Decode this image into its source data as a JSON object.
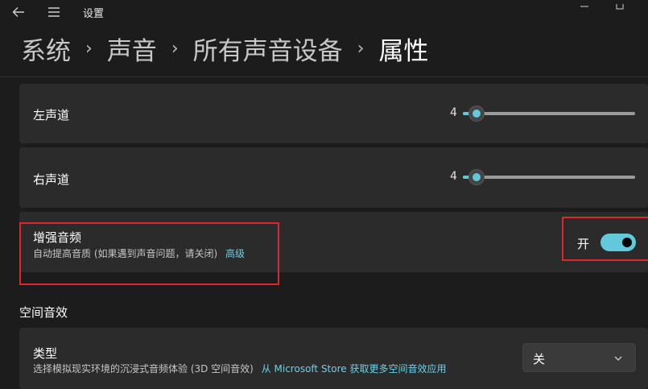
{
  "titlebar": {
    "back_icon": "back-arrow-icon",
    "menu_icon": "hamburger-menu-icon",
    "title": "设置",
    "minimize_icon": "minimize-icon",
    "maximize_icon": "maximize-icon"
  },
  "breadcrumb": {
    "items": [
      "系统",
      "声音",
      "所有声音设备",
      "属性"
    ],
    "separator": "›"
  },
  "left_channel": {
    "label": "左声道",
    "value": "4",
    "level_percent": 4
  },
  "right_channel": {
    "label": "右声道",
    "value": "4",
    "level_percent": 4
  },
  "enhance_audio": {
    "label": "增强音频",
    "description": "自动提高音质 (如果遇到声音问题，请关闭)",
    "link": "高级",
    "toggle_state": "开",
    "toggle_on": true
  },
  "spatial": {
    "section_title": "空间音效",
    "type_label": "类型",
    "type_description": "选择模拟现实环境的沉浸式音频体验 (3D 空间音效)",
    "store_link": "从 Microsoft Store 获取更多空间音效应用",
    "dropdown_value": "关",
    "dropdown_icon": "chevron-down-icon"
  },
  "colors": {
    "accent": "#62c9dc",
    "highlight": "#e0262c",
    "background": "#1c1c1c",
    "card": "#2b2b2b"
  }
}
